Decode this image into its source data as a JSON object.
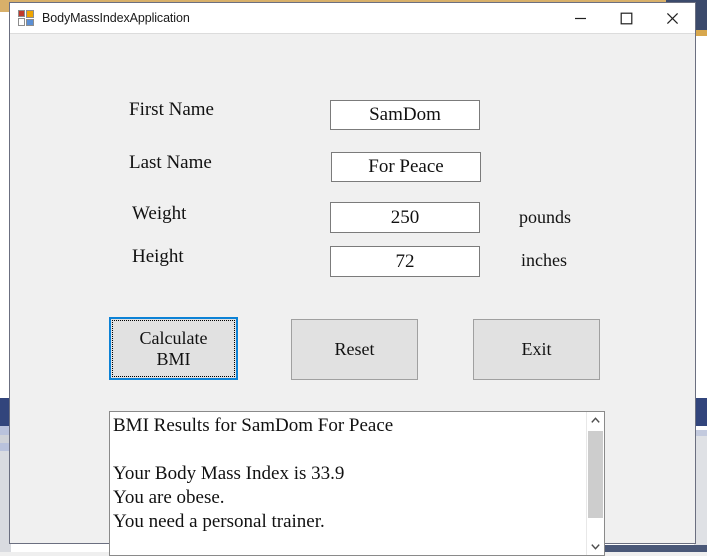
{
  "window": {
    "title": "BodyMassIndexApplication",
    "icon": "winforms-app-icon",
    "controls": {
      "minimize_label": "Minimize",
      "maximize_label": "Maximize",
      "close_label": "Close"
    }
  },
  "form": {
    "fields": [
      {
        "label": "First Name",
        "value": "SamDom",
        "unit": "",
        "name": "first-name"
      },
      {
        "label": "Last Name",
        "value": "For Peace",
        "unit": "",
        "name": "last-name"
      },
      {
        "label": "Weight",
        "value": "250",
        "unit": "pounds",
        "name": "weight"
      },
      {
        "label": "Height",
        "value": "72",
        "unit": "inches",
        "name": "height"
      }
    ],
    "buttons": [
      {
        "label": "Calculate\nBMI",
        "name": "calculate-bmi",
        "focused": true
      },
      {
        "label": "Reset",
        "name": "reset",
        "focused": false
      },
      {
        "label": "Exit",
        "name": "exit",
        "focused": false
      }
    ],
    "results": {
      "text": "BMI Results for SamDom For Peace\n\nYour Body Mass Index is 33.9\nYou are obese.\nYou need a personal trainer.",
      "heading_line": "BMI Results for SamDom For Peace",
      "bmi_line": "Your Body Mass Index is 33.9",
      "category_line": "You are obese.",
      "advice_line": "You need a personal trainer.",
      "bmi_value": "33.9"
    }
  },
  "colors": {
    "focus_border": "#0c82d6",
    "window_face": "#f0f0f0",
    "button_face": "#e1e1e1",
    "title_bar": "#ffffff",
    "scrollbar_thumb": "#cdcdcd"
  }
}
